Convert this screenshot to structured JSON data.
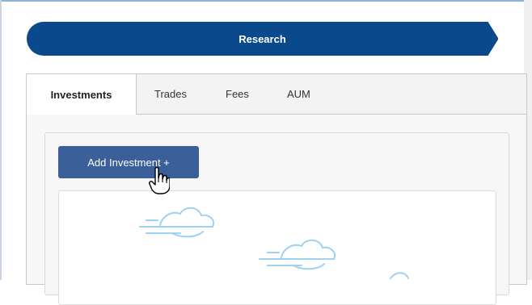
{
  "progress": {
    "current_step": "Research",
    "colors": {
      "active": "#0a4a8c",
      "text": "#ffffff"
    }
  },
  "tabs": [
    {
      "label": "Investments",
      "active": true
    },
    {
      "label": "Trades",
      "active": false
    },
    {
      "label": "Fees",
      "active": false
    },
    {
      "label": "AUM",
      "active": false
    }
  ],
  "actions": {
    "add_investment_label": "Add Investment +"
  },
  "empty_state": {
    "illustration": "clouds-icon"
  },
  "colors": {
    "button": "#3b5f98",
    "cloud_stroke": "#9fd2f0",
    "border": "#c8c8c8"
  },
  "cursor_icon": "hand-pointer-icon"
}
